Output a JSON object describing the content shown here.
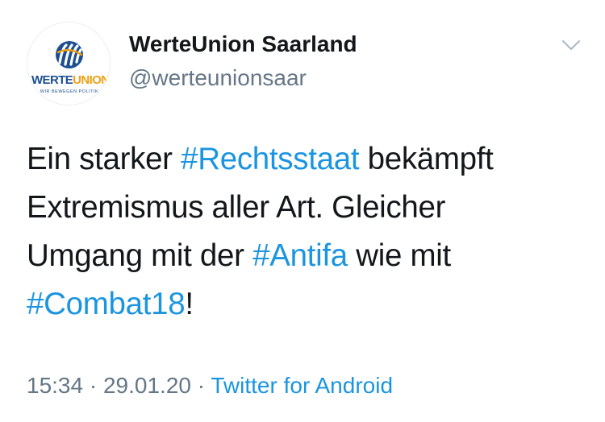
{
  "account": {
    "display_name": "WerteUnion Saarland",
    "handle": "@werteunionsaar",
    "avatar_logo": {
      "word_part1": "WERTE",
      "word_part2": "UNION",
      "tagline": "WIR BEWEGEN POLITIK",
      "primary_color": "#1d4f91",
      "accent_color": "#f0a012"
    }
  },
  "menu": {
    "icon": "chevron-down-icon"
  },
  "tweet": {
    "lines": [
      [
        {
          "text": "Ein starker ",
          "hashtag": false
        },
        {
          "text": "#Rechtsstaat",
          "hashtag": true
        },
        {
          "text": " bekämpft",
          "hashtag": false
        }
      ],
      [
        {
          "text": "Extremismus aller Art. Gleicher",
          "hashtag": false
        }
      ],
      [
        {
          "text": "Umgang mit der ",
          "hashtag": false
        },
        {
          "text": "#Antifa",
          "hashtag": true
        },
        {
          "text": " wie mit",
          "hashtag": false
        }
      ],
      [
        {
          "text": "#Combat18",
          "hashtag": true
        },
        {
          "text": "!",
          "hashtag": false
        }
      ]
    ],
    "hashtag_color": "#1b95e0"
  },
  "meta": {
    "time": "15:34",
    "separator": " · ",
    "date": "29.01.20",
    "source": "Twitter for Android"
  }
}
